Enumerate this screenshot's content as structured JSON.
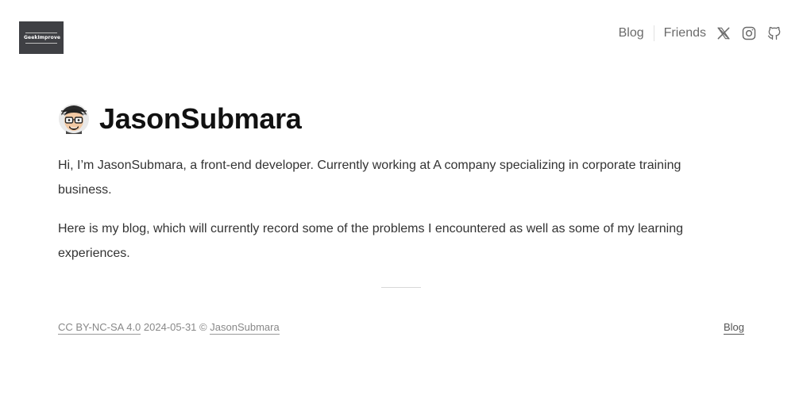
{
  "header": {
    "logo_text": "GeekImprove",
    "nav": {
      "blog_label": "Blog",
      "friends_label": "Friends",
      "icons": [
        "x-twitter-icon",
        "instagram-icon",
        "github-icon"
      ]
    }
  },
  "main": {
    "title": "JasonSubmara",
    "paragraphs": [
      "Hi, I’m JasonSubmara, a front-end developer. Currently working at A company specializing in corporate training business.",
      "Here is my blog, which will currently record some of the problems I encountered as well as some of my learning experiences."
    ]
  },
  "footer": {
    "license": "CC BY-NC-SA 4.0",
    "date": "2024-05-31",
    "copyright": "©",
    "author": "JasonSubmara",
    "blog_link": "Blog"
  },
  "colors": {
    "logo_bg": "#3f4044",
    "nav_text": "#6b6b6b",
    "footer_text": "#888888"
  }
}
